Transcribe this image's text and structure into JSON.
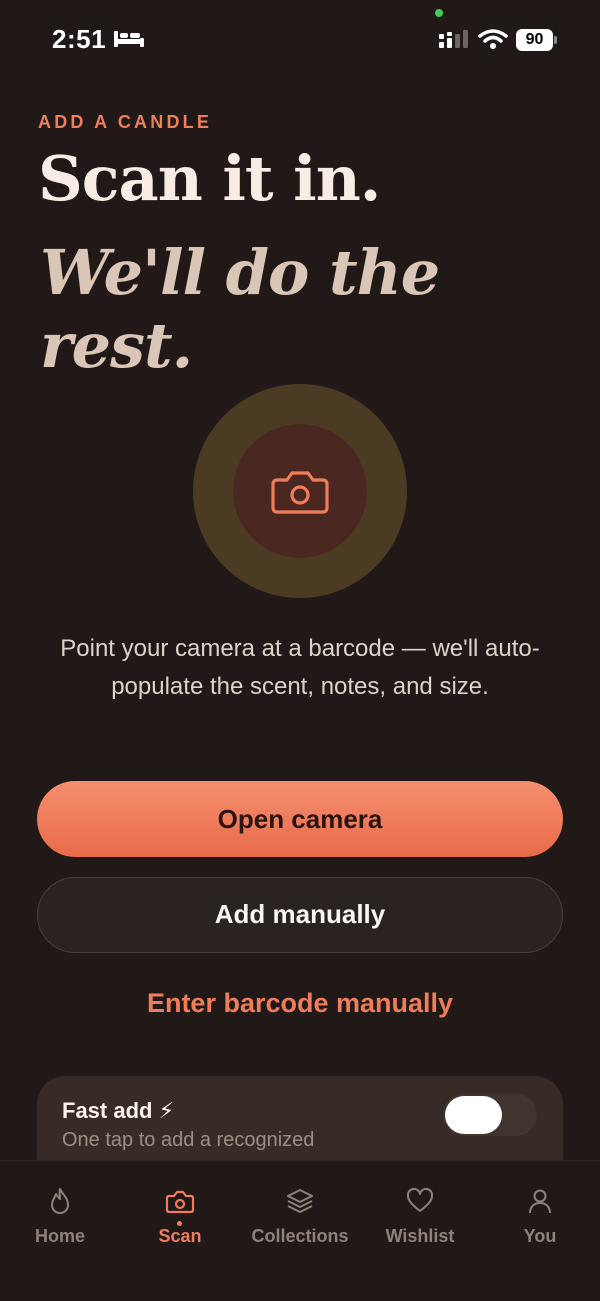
{
  "status_bar": {
    "time": "2:51",
    "battery": "90",
    "icons": [
      "bed-icon",
      "signal-icon",
      "wifi-icon",
      "battery-icon"
    ]
  },
  "header": {
    "eyebrow": "ADD A CANDLE",
    "title": "Scan it in.",
    "subtitle": "We'll do the rest."
  },
  "scan": {
    "icon": "camera-icon",
    "description": "Point your camera at a barcode — we'll auto-populate the scent, notes, and size."
  },
  "actions": {
    "open_camera": "Open camera",
    "add_manually": "Add manually",
    "enter_barcode": "Enter barcode manually"
  },
  "fast_add": {
    "title": "Fast add ⚡",
    "description": "One tap to add a recognized",
    "enabled": true
  },
  "tabs": [
    {
      "label": "Home",
      "icon": "flame-icon",
      "active": false
    },
    {
      "label": "Scan",
      "icon": "camera-icon",
      "active": true
    },
    {
      "label": "Collections",
      "icon": "layers-icon",
      "active": false
    },
    {
      "label": "Wishlist",
      "icon": "heart-icon",
      "active": false
    },
    {
      "label": "You",
      "icon": "user-icon",
      "active": false
    }
  ],
  "colors": {
    "background": "#201917",
    "accent": "#ef7d5c",
    "card": "#362b27"
  }
}
